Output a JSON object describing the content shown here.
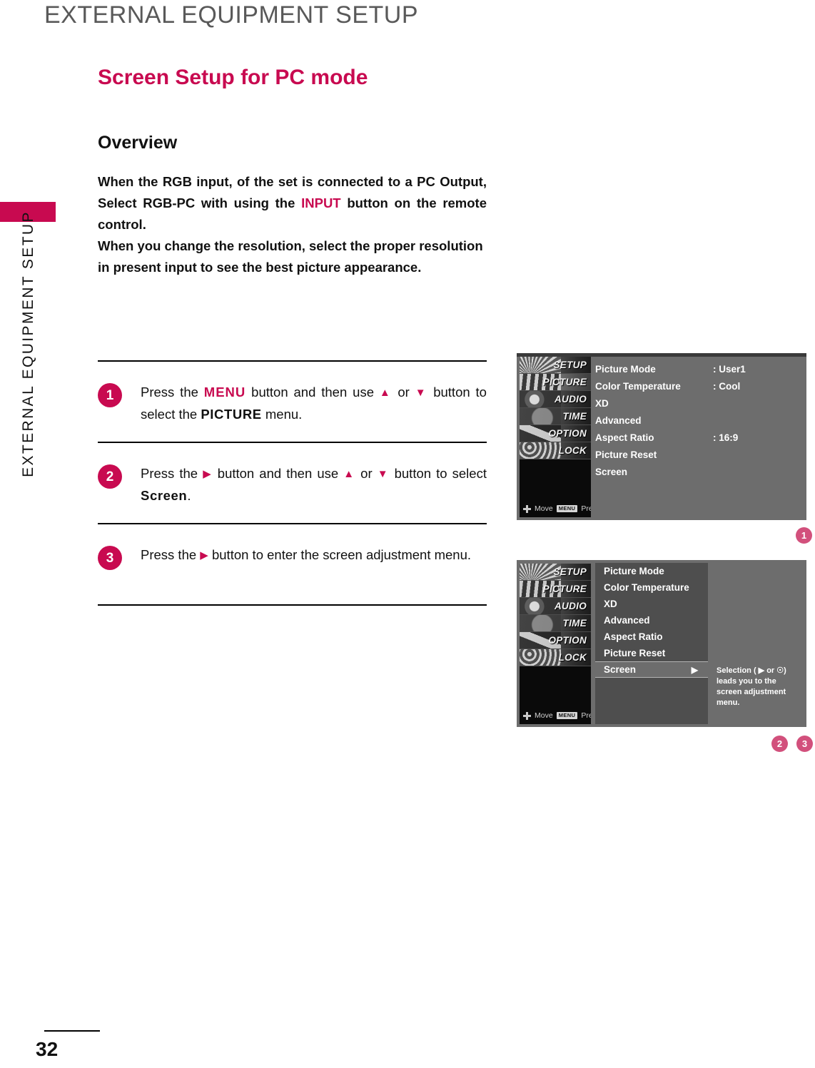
{
  "page": {
    "header_title": "EXTERNAL EQUIPMENT SETUP",
    "side_tab_text": "EXTERNAL EQUIPMENT SETUP",
    "section_title": "Screen Setup for PC mode",
    "page_number": "32",
    "accent_color": "#c80a50",
    "badge_color": "#d2507c"
  },
  "overview": {
    "heading": "Overview",
    "para1_before": "When the RGB input, of the set is connected to a PC Output, Select RGB-PC with using the ",
    "para1_accent": "INPUT",
    "para1_after": " button on the remote control.",
    "para2": "When you change the resolution, select the proper resolution in present input to see the best picture appearance."
  },
  "steps": [
    {
      "number": "1",
      "t1": "Press the ",
      "key": "MENU",
      "t2": " button and then use ",
      "up": "▲",
      "t3": " or ",
      "down": "▼",
      "t4": " button to select the ",
      "bold": "PICTURE",
      "t5": " menu."
    },
    {
      "number": "2",
      "t1": "Press the ",
      "key": "▶",
      "t2": " button and then use ",
      "up": "▲",
      "t3": " or ",
      "down": "▼",
      "t4": " button to select ",
      "bold": "Screen",
      "t5": "."
    },
    {
      "number": "3",
      "t1": "Press the ",
      "key": "▶",
      "t2": " button to enter the screen adjustment menu.",
      "up": "",
      "t3": "",
      "down": "",
      "t4": "",
      "bold": "",
      "t5": ""
    }
  ],
  "osd_sidebar": {
    "items": [
      "SETUP",
      "PICTURE",
      "AUDIO",
      "TIME",
      "OPTION",
      "LOCK"
    ],
    "selected": "PICTURE",
    "move_label": "Move",
    "menu_key_label": "MENU",
    "prev_label": "Prev"
  },
  "osd_picture_menu": {
    "ref": "1",
    "rows": [
      {
        "label": "Picture Mode",
        "value": ": User1"
      },
      {
        "label": "Color Temperature",
        "value": ": Cool"
      },
      {
        "label": "XD",
        "value": ""
      },
      {
        "label": "Advanced",
        "value": ""
      },
      {
        "label": "Aspect Ratio",
        "value": ": 16:9"
      },
      {
        "label": "Picture Reset",
        "value": ""
      },
      {
        "label": "Screen",
        "value": ""
      }
    ]
  },
  "osd_screen_menu": {
    "ref_2": "2",
    "ref_3": "3",
    "rows": [
      "Picture Mode",
      "Color Temperature",
      "XD",
      "Advanced",
      "Aspect Ratio",
      "Picture Reset"
    ],
    "active_row": "Screen",
    "active_arrow": "▶",
    "info_text": "Selection ( ▶ or ☉) leads you to the screen adjustment menu."
  }
}
